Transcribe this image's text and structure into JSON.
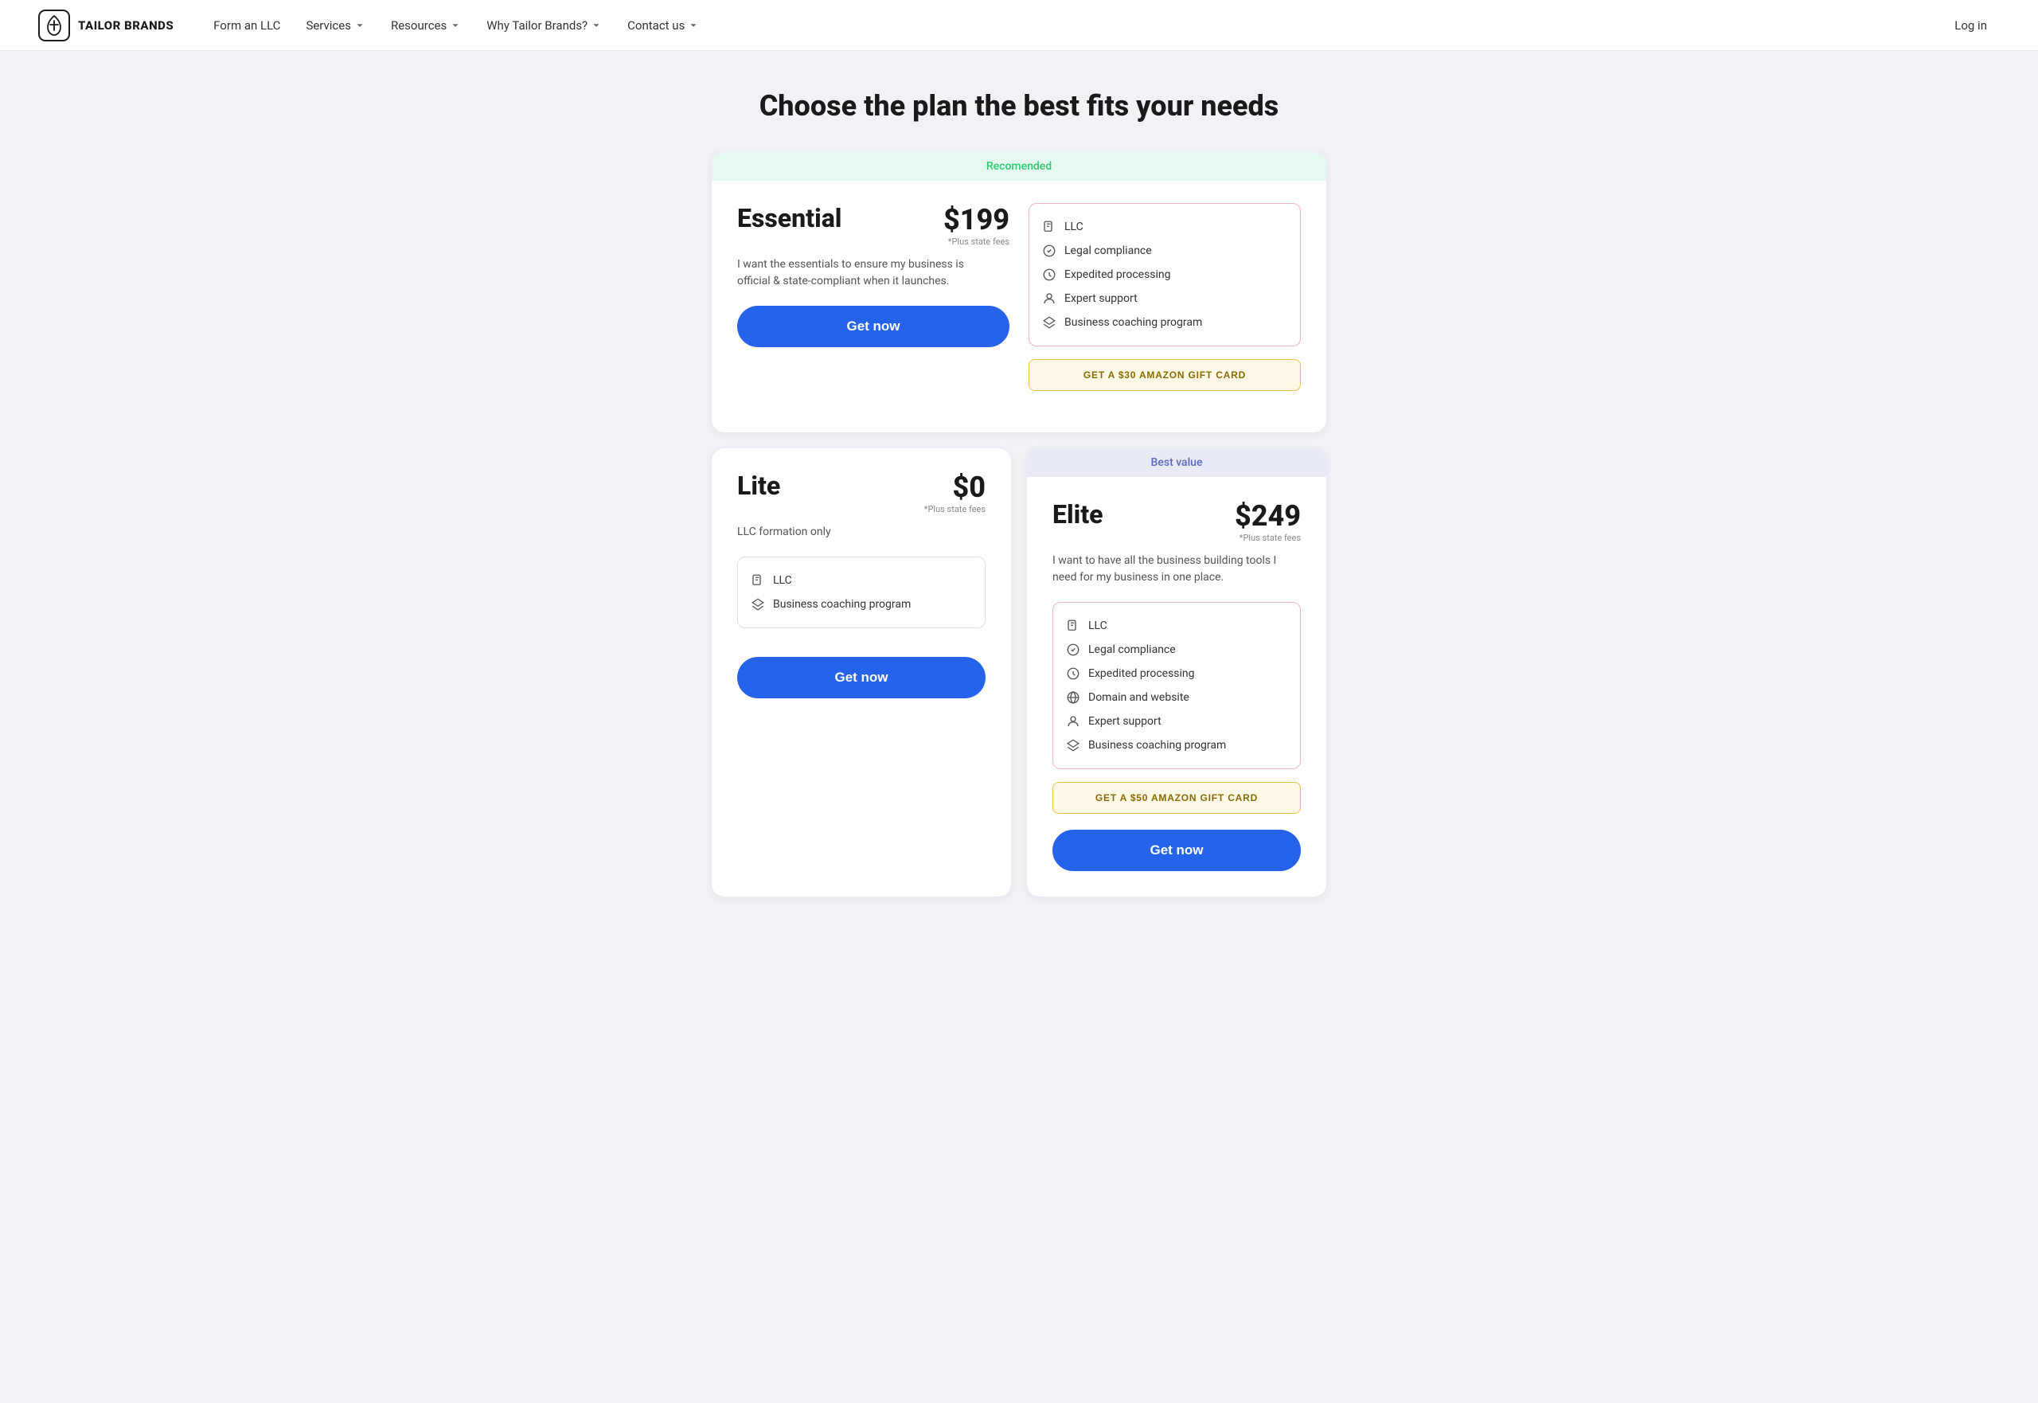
{
  "brand": {
    "name": "TAILOR BRANDS",
    "logo_alt": "Tailor Brands logo"
  },
  "nav": {
    "form_llc": "Form an LLC",
    "services": "Services",
    "resources": "Resources",
    "why_tailor": "Why Tailor Brands?",
    "contact_us": "Contact us",
    "login": "Log in"
  },
  "page": {
    "title": "Choose the plan the best fits your needs"
  },
  "plans": {
    "essential": {
      "badge": "Recomended",
      "name": "Essential",
      "price": "$199",
      "price_note": "*Plus state fees",
      "description": "I want the essentials to ensure my business is official & state-compliant when it launches.",
      "features": [
        "LLC",
        "Legal compliance",
        "Expedited processing",
        "Expert support",
        "Business coaching program"
      ],
      "gift_card": "GET A $30 AMAZON GIFT CARD",
      "cta": "Get now"
    },
    "lite": {
      "name": "Lite",
      "price": "$0",
      "price_note": "*Plus state fees",
      "description": "LLC formation only",
      "features": [
        "LLC",
        "Business coaching program"
      ],
      "cta": "Get now"
    },
    "elite": {
      "badge": "Best value",
      "name": "Elite",
      "price": "$249",
      "price_note": "*Plus state fees",
      "description": "I want to have all the business building tools I need for my business in one place.",
      "features": [
        "LLC",
        "Legal compliance",
        "Expedited processing",
        "Domain and website",
        "Expert support",
        "Business coaching program"
      ],
      "gift_card": "GET A $50 AMAZON GIFT CARD",
      "cta": "Get now"
    }
  }
}
